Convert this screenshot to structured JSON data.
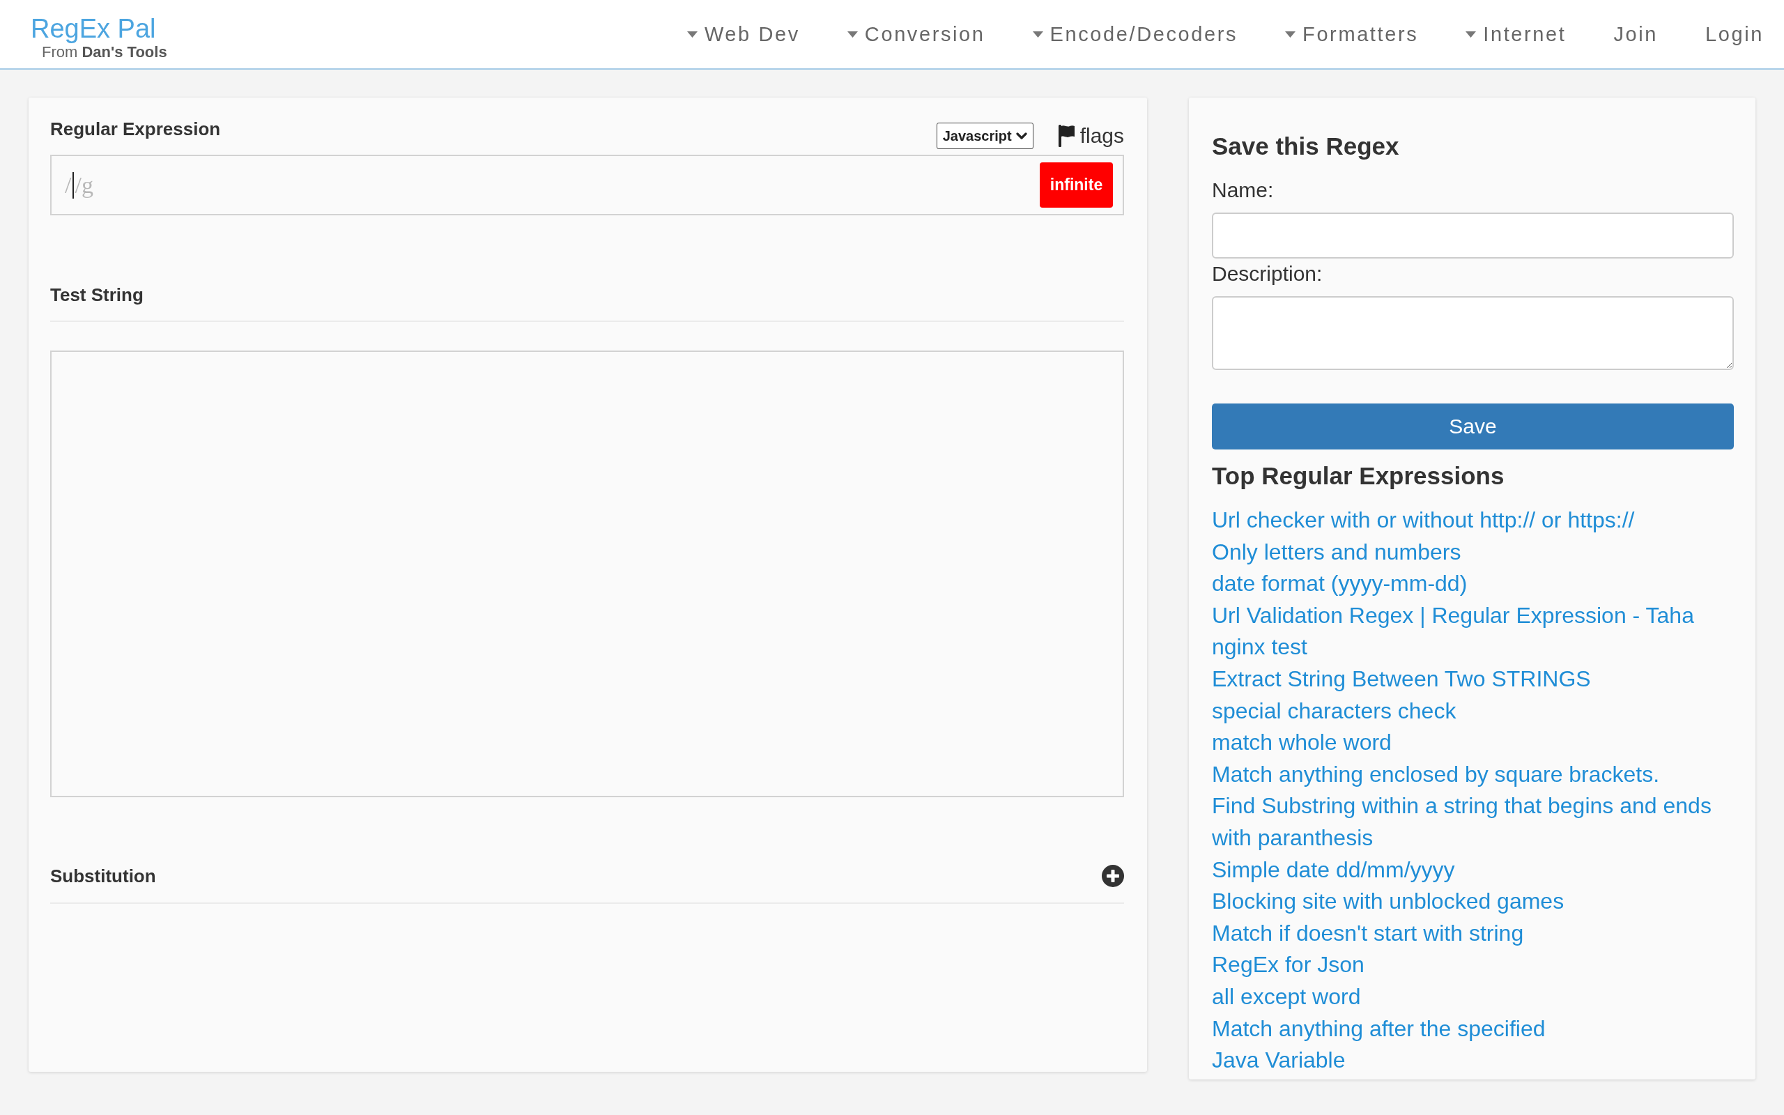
{
  "header": {
    "logo": "RegEx Pal",
    "tagline": "From **Dan's Tools**",
    "nav": [
      {
        "label": "Web Dev",
        "kind": "dropdown"
      },
      {
        "label": "Conversion",
        "kind": "dropdown"
      },
      {
        "label": "Encode/Decoders",
        "kind": "dropdown"
      },
      {
        "label": "Formatters",
        "kind": "dropdown"
      },
      {
        "label": "Internet",
        "kind": "dropdown"
      },
      {
        "label": "Join",
        "kind": "link"
      },
      {
        "label": "Login",
        "kind": "link"
      }
    ]
  },
  "regex_panel": {
    "title": "Regular Expression",
    "language_select": {
      "value": "Javascript"
    },
    "flags_label": "flags",
    "regex_field": {
      "prefix": "/",
      "suffix": "/g",
      "focused": true
    },
    "status_button": "infinite",
    "test_string": {
      "title": "Test String"
    },
    "substitution": {
      "title": "Substitution",
      "expanded": false
    }
  },
  "save_panel": {
    "title": "Save this Regex",
    "name_label": "Name:",
    "description_label": "Description:",
    "save_button": "Save"
  },
  "top_regex": {
    "title": "Top Regular Expressions",
    "items": [
      "Url checker with or without http:// or https://",
      "Only letters and numbers",
      "date format (yyyy-mm-dd)",
      "Url Validation Regex | Regular Expression - Taha",
      "nginx test",
      "Extract String Between Two STRINGS",
      "special characters check",
      "match whole word",
      "Match anything enclosed by square brackets.",
      "Find Substring within a string that begins and ends with paranthesis",
      "Simple date dd/mm/yyyy",
      "Blocking site with unblocked games",
      "Match if doesn't start with string",
      "RegEx for Json",
      "all except word",
      "Match anything after the specified",
      "Java Variable"
    ]
  }
}
